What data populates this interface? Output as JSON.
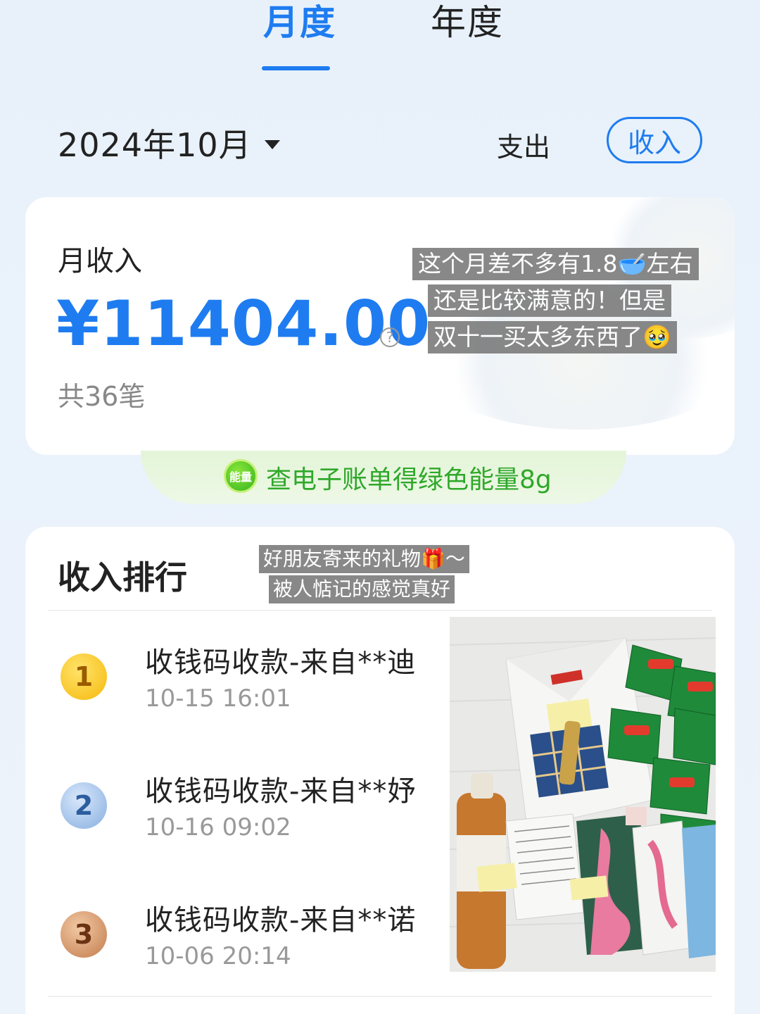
{
  "tabs": {
    "monthly": "月度",
    "yearly": "年度"
  },
  "period": {
    "date": "2024年10月"
  },
  "type_toggle": {
    "expense": "支出",
    "income": "收入"
  },
  "income_card": {
    "label": "月收入",
    "amount": "¥11404.00",
    "help_glyph": "?",
    "count": "共36笔"
  },
  "caption_top": {
    "line1": "这个月差不多有1.8🥣左右",
    "line2": "还是比较满意的！但是",
    "line3": "双十一买太多东西了🥹"
  },
  "energy": {
    "badge": "能量",
    "text": "查电子账单得绿色能量8g"
  },
  "ranking": {
    "title": "收入排行",
    "caption_line1": "好朋友寄来的礼物🎁～",
    "caption_line2": "被人惦记的感觉真好",
    "items": [
      {
        "rank": "1",
        "title": "收钱码收款-来自**迪",
        "time": "10-15 16:01"
      },
      {
        "rank": "2",
        "title": "收钱码收款-来自**妤",
        "time": "10-16 09:02"
      },
      {
        "rank": "3",
        "title": "收钱码收款-来自**诺",
        "time": "10-06 20:14"
      }
    ]
  },
  "colors": {
    "accent": "#1e7cf0",
    "energy_green": "#2fa82a"
  }
}
